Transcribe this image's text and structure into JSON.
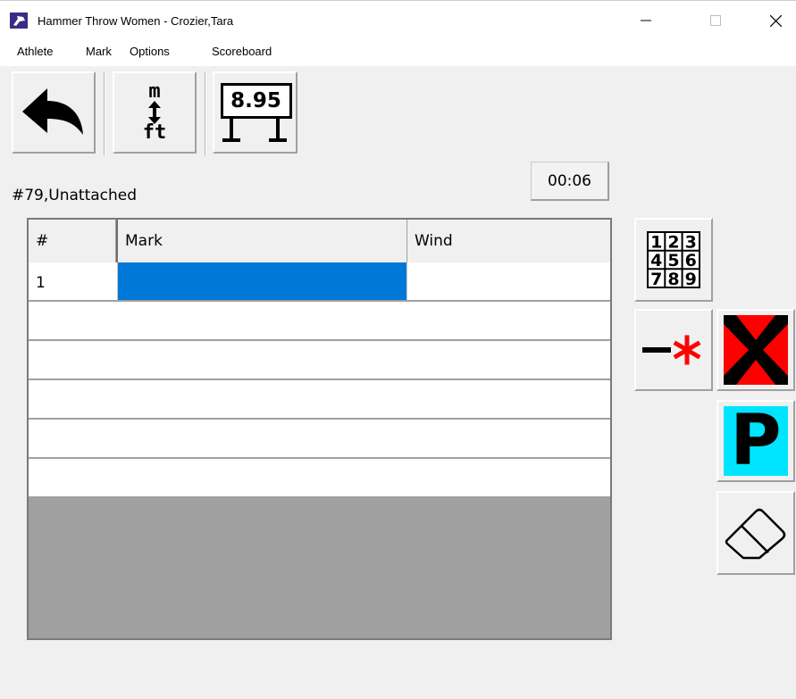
{
  "window": {
    "title": "Hammer Throw Women - Crozier,Tara",
    "controls": {
      "minimize": "minimize",
      "maximize": "maximize",
      "close": "close"
    }
  },
  "menu": [
    "Athlete",
    "Mark",
    "Options",
    "Scoreboard"
  ],
  "toolbar": {
    "back_icon": "back-arrow-icon",
    "units_top": "m",
    "units_bottom": "ft",
    "scoreboard_value": "8.95"
  },
  "timer": "00:06",
  "athlete_info": "#79,Unattached",
  "table": {
    "columns": [
      "#",
      "Mark",
      "Wind"
    ],
    "rows": [
      [
        "1",
        "",
        ""
      ],
      [
        "",
        "",
        ""
      ],
      [
        "",
        "",
        ""
      ],
      [
        "",
        "",
        ""
      ],
      [
        "",
        "",
        ""
      ],
      [
        "",
        "",
        ""
      ]
    ],
    "selected_color": "#0078d7"
  },
  "side_buttons": {
    "keypad_digits": [
      "1",
      "2",
      "3",
      "4",
      "5",
      "6",
      "7",
      "8",
      "9"
    ],
    "foul_color": "#ff0000",
    "pass_letter": "P",
    "pass_color": "#00e5ff",
    "icons": [
      "keypad-icon",
      "minus-star-icon",
      "foul-x-icon",
      "pass-icon",
      "eraser-icon"
    ]
  }
}
